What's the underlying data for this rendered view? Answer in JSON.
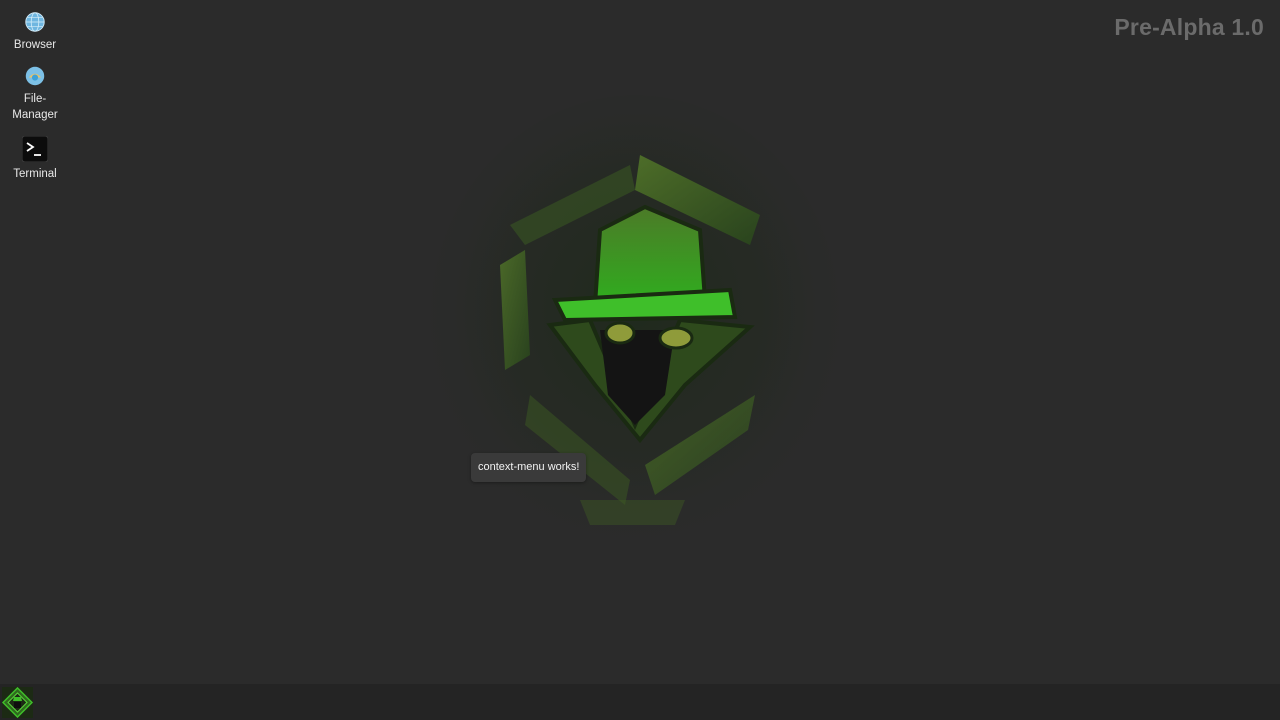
{
  "desktop": {
    "version_label": "Pre-Alpha 1.0",
    "icons": [
      {
        "label": "Browser",
        "icon": "globe-icon"
      },
      {
        "label": "File-\nManager",
        "icon": "file-manager-icon"
      },
      {
        "label": "Terminal",
        "icon": "terminal-icon"
      }
    ],
    "context_menu_text": "context-menu works!"
  },
  "taskbar": {
    "start_icon": "hacker-logo-icon"
  },
  "colors": {
    "background": "#2b2b2b",
    "taskbar": "#242424",
    "accent_green": "#3fbf2a",
    "version_text": "#6b6b6b"
  }
}
